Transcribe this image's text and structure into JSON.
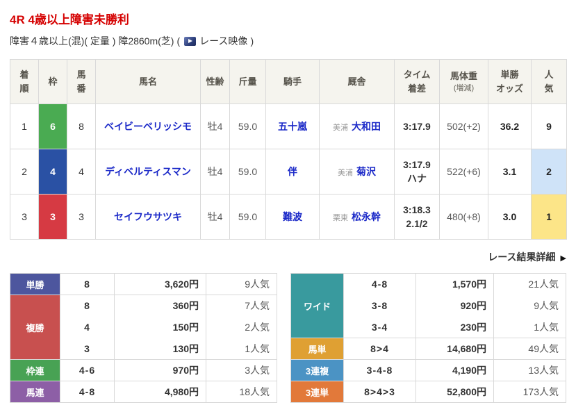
{
  "colors": {
    "title_red": "#d50000",
    "link_blue": "#1b29c8",
    "frame_green": "#4aab52",
    "frame_blue": "#2a51a4",
    "frame_red": "#d63a43",
    "pop2_bg": "#cfe3f8",
    "pop1_bg": "#fce588"
  },
  "header": {
    "race_title": "4R 4歳以上障害未勝利",
    "conditions": "障害４歳以上(混)( 定量 ) 障2860m(芝)",
    "video_open": "(",
    "video_label": "レース映像",
    "video_close": ")"
  },
  "results": {
    "headers": [
      {
        "l1": "着",
        "l2": "順"
      },
      {
        "l1": "枠",
        "l2": ""
      },
      {
        "l1": "馬",
        "l2": "番"
      },
      {
        "l1": "馬名",
        "l2": ""
      },
      {
        "l1": "性齢",
        "l2": ""
      },
      {
        "l1": "斤量",
        "l2": ""
      },
      {
        "l1": "騎手",
        "l2": ""
      },
      {
        "l1": "厩舎",
        "l2": ""
      },
      {
        "l1": "タイム",
        "l2": "着差"
      },
      {
        "l1": "馬体重",
        "l2": "(増減)"
      },
      {
        "l1": "単勝",
        "l2": "オッズ"
      },
      {
        "l1": "人",
        "l2": "気"
      }
    ],
    "rows": [
      {
        "finish": "1",
        "frame": "6",
        "frame_color": "#4aab52",
        "number": "8",
        "horse": "ベイビーベリッシモ",
        "sex_age": "牡4",
        "weight": "59.0",
        "jockey": "五十嵐",
        "region": "美浦",
        "trainer": "大和田",
        "time": "3:17.9",
        "margin": "",
        "body_weight": "502(+2)",
        "odds": "36.2",
        "popularity": "9"
      },
      {
        "finish": "2",
        "frame": "4",
        "frame_color": "#2a51a4",
        "number": "4",
        "horse": "ディベルティスマン",
        "sex_age": "牡4",
        "weight": "59.0",
        "jockey": "伴",
        "region": "美浦",
        "trainer": "菊沢",
        "time": "3:17.9",
        "margin": "ハナ",
        "body_weight": "522(+6)",
        "odds": "3.1",
        "popularity": "2",
        "pop_bg": "#cfe3f8"
      },
      {
        "finish": "3",
        "frame": "3",
        "frame_color": "#d63a43",
        "number": "3",
        "horse": "セイフウサツキ",
        "sex_age": "牡4",
        "weight": "59.0",
        "jockey": "難波",
        "region": "栗東",
        "trainer": "松永幹",
        "time": "3:18.3",
        "margin": "2.1/2",
        "body_weight": "480(+8)",
        "odds": "3.0",
        "popularity": "1",
        "pop_bg": "#fce588"
      }
    ]
  },
  "results_link": {
    "label": "レース結果詳細",
    "arrow": "▶"
  },
  "payouts": {
    "left": [
      {
        "label": "単勝",
        "color": "#4d569e",
        "rows": [
          {
            "combo": "8",
            "amount": "3,620円",
            "pop": "9人気"
          }
        ]
      },
      {
        "label": "複勝",
        "color": "#c8504f",
        "rows": [
          {
            "combo": "8",
            "amount": "360円",
            "pop": "7人気"
          },
          {
            "combo": "4",
            "amount": "150円",
            "pop": "2人気"
          },
          {
            "combo": "3",
            "amount": "130円",
            "pop": "1人気"
          }
        ]
      },
      {
        "label": "枠連",
        "color": "#48a254",
        "rows": [
          {
            "combo": "4-6",
            "amount": "970円",
            "pop": "3人気"
          }
        ]
      },
      {
        "label": "馬連",
        "color": "#8d5fa6",
        "rows": [
          {
            "combo": "4-8",
            "amount": "4,980円",
            "pop": "18人気"
          }
        ]
      }
    ],
    "right": [
      {
        "label": "ワイド",
        "color": "#399a9e",
        "rows": [
          {
            "combo": "4-8",
            "amount": "1,570円",
            "pop": "21人気"
          },
          {
            "combo": "3-8",
            "amount": "920円",
            "pop": "9人気"
          },
          {
            "combo": "3-4",
            "amount": "230円",
            "pop": "1人気"
          }
        ]
      },
      {
        "label": "馬単",
        "color": "#dfa033",
        "rows": [
          {
            "combo": "8>4",
            "amount": "14,680円",
            "pop": "49人気"
          }
        ]
      },
      {
        "label": "3連複",
        "color": "#4b93c4",
        "rows": [
          {
            "combo": "3-4-8",
            "amount": "4,190円",
            "pop": "13人気"
          }
        ]
      },
      {
        "label": "3連単",
        "color": "#e2793a",
        "rows": [
          {
            "combo": "8>4>3",
            "amount": "52,800円",
            "pop": "173人気"
          }
        ]
      }
    ]
  }
}
